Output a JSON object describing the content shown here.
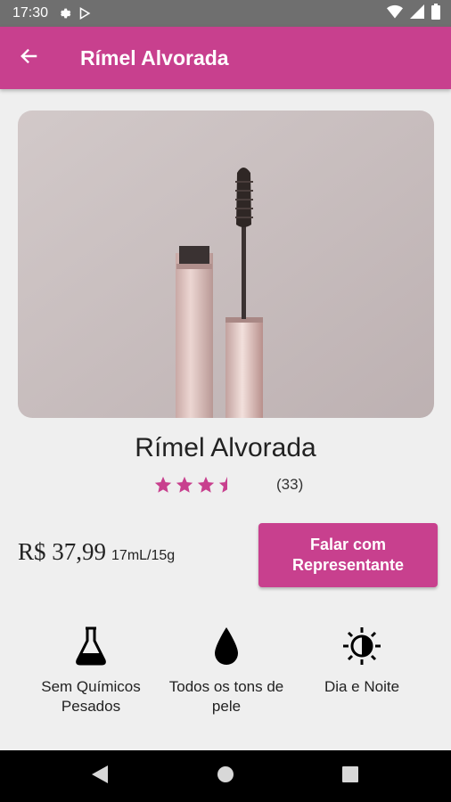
{
  "status_bar": {
    "time": "17:30"
  },
  "app_bar": {
    "title": "Rímel Alvorada"
  },
  "product": {
    "name": "Rímel Alvorada",
    "rating": 3.5,
    "review_count": "(33)",
    "price": "R$ 37,99",
    "size": "17mL/15g",
    "contact_label": "Falar com Representante"
  },
  "features": [
    {
      "icon": "flask-icon",
      "label": "Sem Químicos Pesados"
    },
    {
      "icon": "drop-icon",
      "label": "Todos os tons de pele"
    },
    {
      "icon": "day-night-icon",
      "label": "Dia e Noite"
    }
  ],
  "colors": {
    "accent": "#c8408e",
    "status_bar": "#6f6f6f",
    "background": "#efefef"
  }
}
